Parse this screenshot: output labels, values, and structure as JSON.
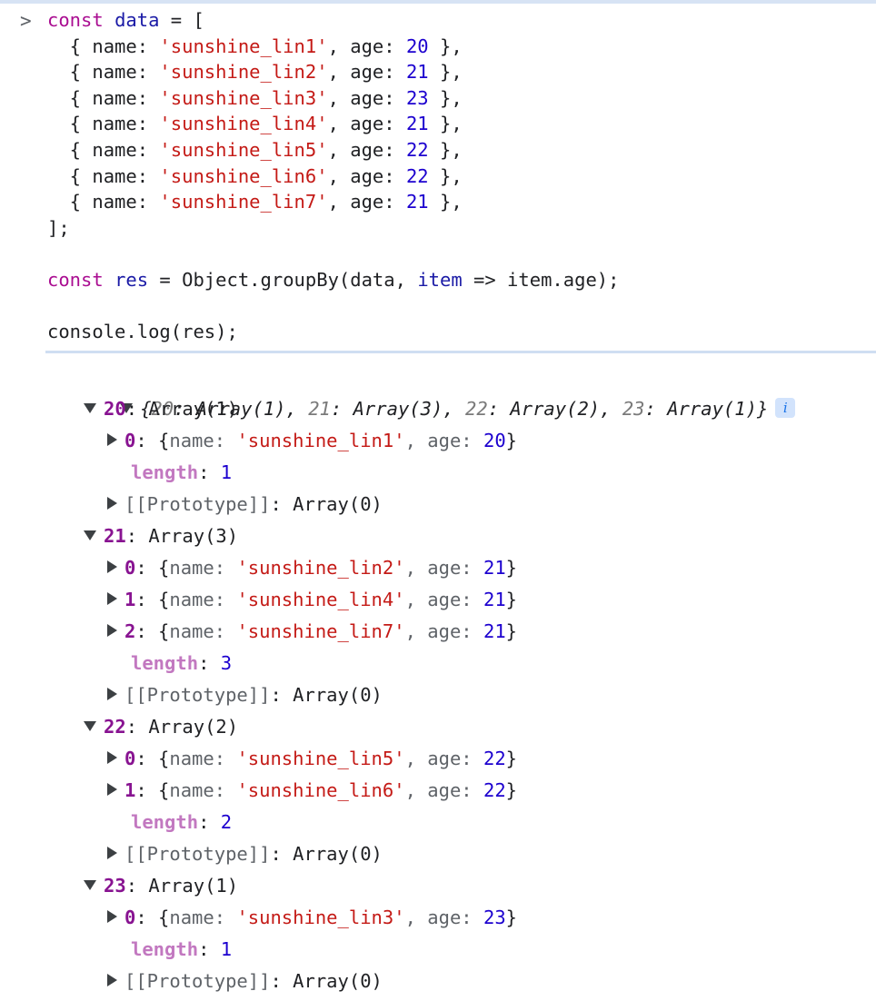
{
  "console": {
    "prompt_symbol": ">",
    "input_lines": [
      [
        {
          "t": "const",
          "c": "kw"
        },
        {
          "t": " ",
          "c": "plain"
        },
        {
          "t": "data",
          "c": "ident"
        },
        {
          "t": " = [",
          "c": "plain"
        }
      ],
      [
        {
          "t": "  { name: ",
          "c": "plain"
        },
        {
          "t": "'sunshine_lin1'",
          "c": "str"
        },
        {
          "t": ", age: ",
          "c": "plain"
        },
        {
          "t": "20",
          "c": "num"
        },
        {
          "t": " },",
          "c": "plain"
        }
      ],
      [
        {
          "t": "  { name: ",
          "c": "plain"
        },
        {
          "t": "'sunshine_lin2'",
          "c": "str"
        },
        {
          "t": ", age: ",
          "c": "plain"
        },
        {
          "t": "21",
          "c": "num"
        },
        {
          "t": " },",
          "c": "plain"
        }
      ],
      [
        {
          "t": "  { name: ",
          "c": "plain"
        },
        {
          "t": "'sunshine_lin3'",
          "c": "str"
        },
        {
          "t": ", age: ",
          "c": "plain"
        },
        {
          "t": "23",
          "c": "num"
        },
        {
          "t": " },",
          "c": "plain"
        }
      ],
      [
        {
          "t": "  { name: ",
          "c": "plain"
        },
        {
          "t": "'sunshine_lin4'",
          "c": "str"
        },
        {
          "t": ", age: ",
          "c": "plain"
        },
        {
          "t": "21",
          "c": "num"
        },
        {
          "t": " },",
          "c": "plain"
        }
      ],
      [
        {
          "t": "  { name: ",
          "c": "plain"
        },
        {
          "t": "'sunshine_lin5'",
          "c": "str"
        },
        {
          "t": ", age: ",
          "c": "plain"
        },
        {
          "t": "22",
          "c": "num"
        },
        {
          "t": " },",
          "c": "plain"
        }
      ],
      [
        {
          "t": "  { name: ",
          "c": "plain"
        },
        {
          "t": "'sunshine_lin6'",
          "c": "str"
        },
        {
          "t": ", age: ",
          "c": "plain"
        },
        {
          "t": "22",
          "c": "num"
        },
        {
          "t": " },",
          "c": "plain"
        }
      ],
      [
        {
          "t": "  { name: ",
          "c": "plain"
        },
        {
          "t": "'sunshine_lin7'",
          "c": "str"
        },
        {
          "t": ", age: ",
          "c": "plain"
        },
        {
          "t": "21",
          "c": "num"
        },
        {
          "t": " },",
          "c": "plain"
        }
      ],
      [
        {
          "t": "];",
          "c": "plain"
        }
      ],
      [
        {
          "t": "",
          "c": "plain"
        }
      ],
      [
        {
          "t": "const",
          "c": "kw"
        },
        {
          "t": " ",
          "c": "plain"
        },
        {
          "t": "res",
          "c": "ident"
        },
        {
          "t": " = Object.groupBy(data, ",
          "c": "plain"
        },
        {
          "t": "item",
          "c": "ident"
        },
        {
          "t": " => item.age);",
          "c": "plain"
        }
      ],
      [
        {
          "t": "",
          "c": "plain"
        }
      ],
      [
        {
          "t": "console.log(res);",
          "c": "plain"
        }
      ]
    ],
    "output": {
      "summary": {
        "open_brace": "{",
        "close_brace": "}",
        "entries": [
          {
            "key": "20",
            "value": "Array(1)"
          },
          {
            "key": "21",
            "value": "Array(3)"
          },
          {
            "key": "22",
            "value": "Array(2)"
          },
          {
            "key": "23",
            "value": "Array(1)"
          }
        ],
        "separator": ", ",
        "key_sep": ": ",
        "info_badge": "i"
      },
      "groups": [
        {
          "key": "20",
          "label": "Array(1)",
          "items": [
            {
              "index": "0",
              "preview_open": "{",
              "prop1": "name: ",
              "str": "'sunshine_lin1'",
              "prop2": ", age: ",
              "num": "20",
              "preview_close": "}"
            }
          ],
          "length_key": "length",
          "length_value": "1",
          "prototype_key": "[[Prototype]]",
          "prototype_value": "Array(0)"
        },
        {
          "key": "21",
          "label": "Array(3)",
          "items": [
            {
              "index": "0",
              "preview_open": "{",
              "prop1": "name: ",
              "str": "'sunshine_lin2'",
              "prop2": ", age: ",
              "num": "21",
              "preview_close": "}"
            },
            {
              "index": "1",
              "preview_open": "{",
              "prop1": "name: ",
              "str": "'sunshine_lin4'",
              "prop2": ", age: ",
              "num": "21",
              "preview_close": "}"
            },
            {
              "index": "2",
              "preview_open": "{",
              "prop1": "name: ",
              "str": "'sunshine_lin7'",
              "prop2": ", age: ",
              "num": "21",
              "preview_close": "}"
            }
          ],
          "length_key": "length",
          "length_value": "3",
          "prototype_key": "[[Prototype]]",
          "prototype_value": "Array(0)"
        },
        {
          "key": "22",
          "label": "Array(2)",
          "items": [
            {
              "index": "0",
              "preview_open": "{",
              "prop1": "name: ",
              "str": "'sunshine_lin5'",
              "prop2": ", age: ",
              "num": "22",
              "preview_close": "}"
            },
            {
              "index": "1",
              "preview_open": "{",
              "prop1": "name: ",
              "str": "'sunshine_lin6'",
              "prop2": ", age: ",
              "num": "22",
              "preview_close": "}"
            }
          ],
          "length_key": "length",
          "length_value": "2",
          "prototype_key": "[[Prototype]]",
          "prototype_value": "Array(0)"
        },
        {
          "key": "23",
          "label": "Array(1)",
          "items": [
            {
              "index": "0",
              "preview_open": "{",
              "prop1": "name: ",
              "str": "'sunshine_lin3'",
              "prop2": ", age: ",
              "num": "23",
              "preview_close": "}"
            }
          ],
          "length_key": "length",
          "length_value": "1",
          "prototype_key": "[[Prototype]]",
          "prototype_value": "Array(0)"
        }
      ],
      "colon": ": "
    }
  },
  "colors": {
    "keyword": "#aa0d91",
    "identifier": "#1a1aa6",
    "string": "#c41a16",
    "number": "#1c00cf",
    "object_key": "#881391",
    "length_key": "#c278c0",
    "muted": "#5f6368",
    "divider": "#cfdef2",
    "info_badge_bg": "#d2e3fc",
    "info_badge_fg": "#1a73e8"
  }
}
